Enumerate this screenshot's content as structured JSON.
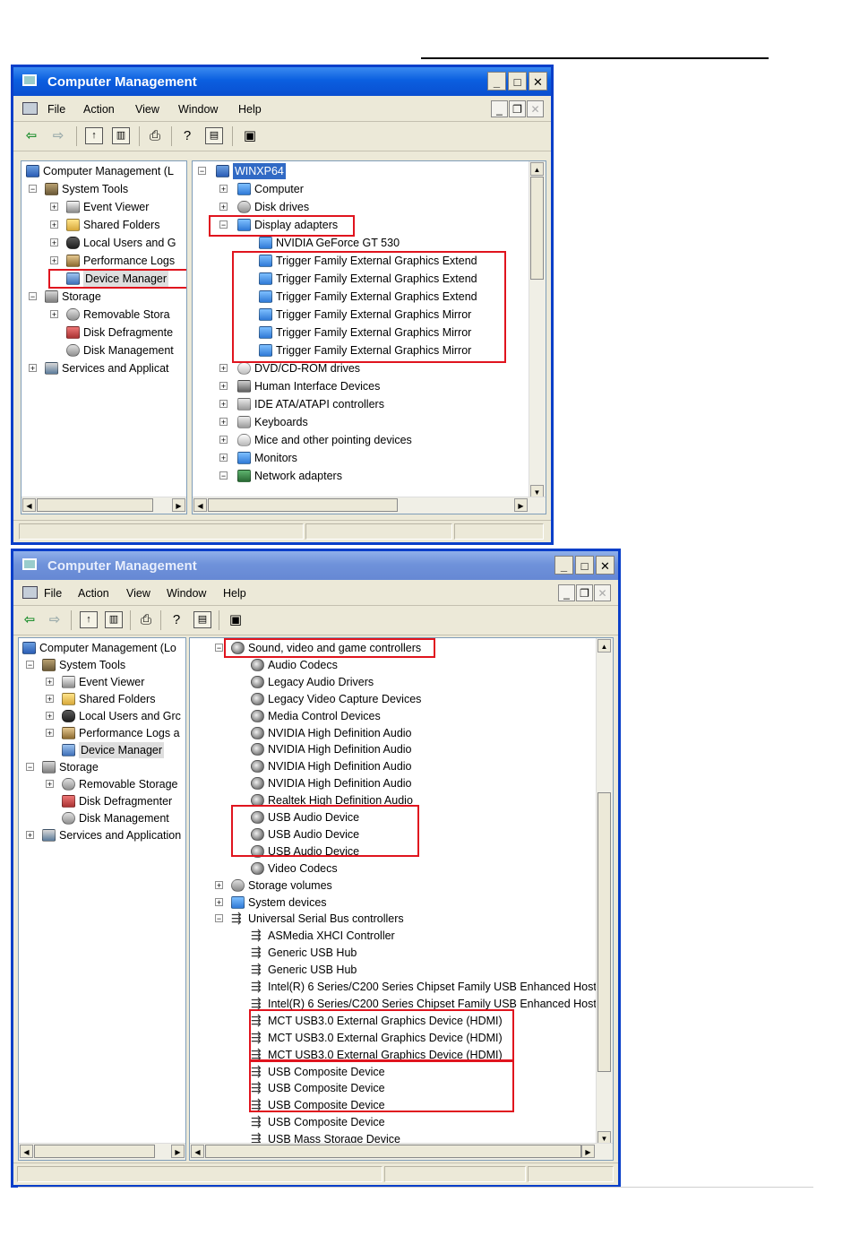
{
  "window1": {
    "title": "Computer Management",
    "caption_buttons": [
      "_",
      "□",
      "✕"
    ],
    "menu": [
      "File",
      "Action",
      "View",
      "Window",
      "Help"
    ],
    "left_tree": [
      {
        "label": "Computer Management (L",
        "icon": "computer-icon",
        "expander": ""
      },
      {
        "label": "System Tools",
        "icon": "tools-icon",
        "expander": "−"
      },
      {
        "label": "Event Viewer",
        "icon": "viewer-icon",
        "expander": "+"
      },
      {
        "label": "Shared Folders",
        "icon": "folder-icon",
        "expander": "+"
      },
      {
        "label": "Local Users and G",
        "icon": "users-icon",
        "expander": "+"
      },
      {
        "label": "Performance Logs",
        "icon": "perf-icon",
        "expander": "+"
      },
      {
        "label": "Device Manager",
        "icon": "devmgr-icon",
        "expander": ""
      },
      {
        "label": "Storage",
        "icon": "storage-icon",
        "expander": "−"
      },
      {
        "label": "Removable Stora",
        "icon": "disk-icon",
        "expander": "+"
      },
      {
        "label": "Disk Defragmente",
        "icon": "defrag-icon",
        "expander": ""
      },
      {
        "label": "Disk Management",
        "icon": "disk-icon",
        "expander": ""
      },
      {
        "label": "Services and Applicat",
        "icon": "services-icon",
        "expander": "+"
      }
    ],
    "right_tree": [
      {
        "label": "WINXP64",
        "icon": "computer-icon",
        "expander": "−"
      },
      {
        "label": "Computer",
        "icon": "monitor-icon",
        "expander": "+"
      },
      {
        "label": "Disk drives",
        "icon": "disk-icon",
        "expander": "+"
      },
      {
        "label": "Display adapters",
        "icon": "monitor-icon",
        "expander": "−"
      },
      {
        "label": "NVIDIA GeForce GT 530",
        "icon": "monitor-icon",
        "expander": ""
      },
      {
        "label": "Trigger Family External Graphics Extend",
        "icon": "monitor-icon",
        "expander": ""
      },
      {
        "label": "Trigger Family External Graphics Extend",
        "icon": "monitor-icon",
        "expander": ""
      },
      {
        "label": "Trigger Family External Graphics Extend",
        "icon": "monitor-icon",
        "expander": ""
      },
      {
        "label": "Trigger Family External Graphics Mirror",
        "icon": "monitor-icon",
        "expander": ""
      },
      {
        "label": "Trigger Family External Graphics Mirror",
        "icon": "monitor-icon",
        "expander": ""
      },
      {
        "label": "Trigger Family External Graphics Mirror",
        "icon": "monitor-icon",
        "expander": ""
      },
      {
        "label": "DVD/CD-ROM drives",
        "icon": "dvd-icon",
        "expander": "+"
      },
      {
        "label": "Human Interface Devices",
        "icon": "hid-icon",
        "expander": "+"
      },
      {
        "label": "IDE ATA/ATAPI controllers",
        "icon": "ide-icon",
        "expander": "+"
      },
      {
        "label": "Keyboards",
        "icon": "keyboard-icon",
        "expander": "+"
      },
      {
        "label": "Mice and other pointing devices",
        "icon": "mouse-icon",
        "expander": "+"
      },
      {
        "label": "Monitors",
        "icon": "monitor-icon",
        "expander": "+"
      },
      {
        "label": "Network adapters",
        "icon": "network-icon",
        "expander": "−"
      }
    ]
  },
  "window2": {
    "title": "Computer Management",
    "caption_buttons": [
      "_",
      "□",
      "✕"
    ],
    "menu": [
      "File",
      "Action",
      "View",
      "Window",
      "Help"
    ],
    "left_tree": [
      {
        "label": "Computer Management (Lo",
        "icon": "computer-icon",
        "expander": ""
      },
      {
        "label": "System Tools",
        "icon": "tools-icon",
        "expander": "−"
      },
      {
        "label": "Event Viewer",
        "icon": "viewer-icon",
        "expander": "+"
      },
      {
        "label": "Shared Folders",
        "icon": "folder-icon",
        "expander": "+"
      },
      {
        "label": "Local Users and Grc",
        "icon": "users-icon",
        "expander": "+"
      },
      {
        "label": "Performance Logs a",
        "icon": "perf-icon",
        "expander": "+"
      },
      {
        "label": "Device Manager",
        "icon": "devmgr-icon",
        "expander": ""
      },
      {
        "label": "Storage",
        "icon": "storage-icon",
        "expander": "−"
      },
      {
        "label": "Removable Storage",
        "icon": "disk-icon",
        "expander": "+"
      },
      {
        "label": "Disk Defragmenter",
        "icon": "defrag-icon",
        "expander": ""
      },
      {
        "label": "Disk Management",
        "icon": "disk-icon",
        "expander": ""
      },
      {
        "label": "Services and Application",
        "icon": "services-icon",
        "expander": "+"
      }
    ],
    "right_tree": [
      {
        "label": "Sound, video and game controllers",
        "icon": "sound-icon",
        "expander": "−"
      },
      {
        "label": "Audio Codecs",
        "icon": "sound-icon",
        "expander": ""
      },
      {
        "label": "Legacy Audio Drivers",
        "icon": "sound-icon",
        "expander": ""
      },
      {
        "label": "Legacy Video Capture Devices",
        "icon": "sound-icon",
        "expander": ""
      },
      {
        "label": "Media Control Devices",
        "icon": "sound-icon",
        "expander": ""
      },
      {
        "label": "NVIDIA High Definition Audio",
        "icon": "sound-icon",
        "expander": ""
      },
      {
        "label": "NVIDIA High Definition Audio",
        "icon": "sound-icon",
        "expander": ""
      },
      {
        "label": "NVIDIA High Definition Audio",
        "icon": "sound-icon",
        "expander": ""
      },
      {
        "label": "NVIDIA High Definition Audio",
        "icon": "sound-icon",
        "expander": ""
      },
      {
        "label": "Realtek High Definition Audio",
        "icon": "sound-icon",
        "expander": ""
      },
      {
        "label": "USB Audio Device",
        "icon": "sound-icon",
        "expander": ""
      },
      {
        "label": "USB Audio Device",
        "icon": "sound-icon",
        "expander": ""
      },
      {
        "label": "USB Audio Device",
        "icon": "sound-icon",
        "expander": ""
      },
      {
        "label": "Video Codecs",
        "icon": "sound-icon",
        "expander": ""
      },
      {
        "label": "Storage volumes",
        "icon": "volume-icon",
        "expander": "+"
      },
      {
        "label": "System devices",
        "icon": "monitor-icon",
        "expander": "+"
      },
      {
        "label": "Universal Serial Bus controllers",
        "icon": "usb-icon",
        "expander": "−"
      },
      {
        "label": "ASMedia XHCI Controller",
        "icon": "usb-icon",
        "expander": ""
      },
      {
        "label": "Generic USB Hub",
        "icon": "usb-icon",
        "expander": ""
      },
      {
        "label": "Generic USB Hub",
        "icon": "usb-icon",
        "expander": ""
      },
      {
        "label": "Intel(R) 6 Series/C200 Series Chipset Family USB Enhanced Host",
        "icon": "usb-icon",
        "expander": ""
      },
      {
        "label": "Intel(R) 6 Series/C200 Series Chipset Family USB Enhanced Host",
        "icon": "usb-icon",
        "expander": ""
      },
      {
        "label": "MCT USB3.0 External Graphics Device (HDMI)",
        "icon": "usb-icon",
        "expander": ""
      },
      {
        "label": "MCT USB3.0 External Graphics Device (HDMI)",
        "icon": "usb-icon",
        "expander": ""
      },
      {
        "label": "MCT USB3.0 External Graphics Device (HDMI)",
        "icon": "usb-icon",
        "expander": ""
      },
      {
        "label": "USB Composite Device",
        "icon": "usb-icon",
        "expander": ""
      },
      {
        "label": "USB Composite Device",
        "icon": "usb-icon",
        "expander": ""
      },
      {
        "label": "USB Composite Device",
        "icon": "usb-icon",
        "expander": ""
      },
      {
        "label": "USB Composite Device",
        "icon": "usb-icon",
        "expander": ""
      },
      {
        "label": "USB Mass Storage Device",
        "icon": "usb-icon",
        "expander": ""
      }
    ]
  },
  "colors": {
    "titlebar_active": "#0b5fe0",
    "titlebar_inactive": "#6f92da",
    "highlight_box": "#e0141e",
    "selection": "#316ac5"
  }
}
